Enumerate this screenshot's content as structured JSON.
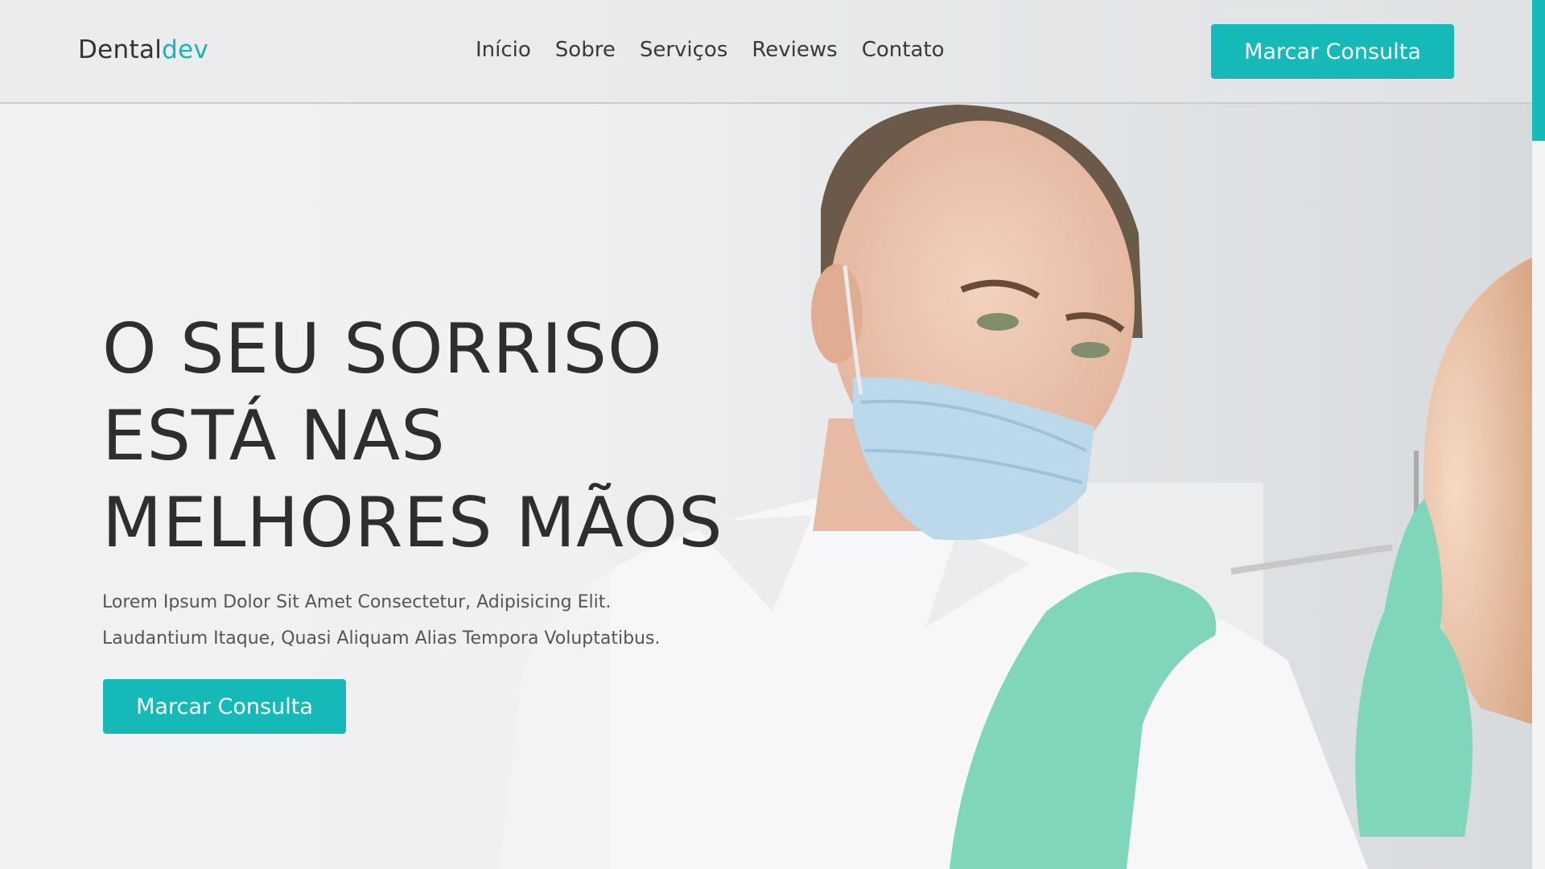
{
  "logo": {
    "part1": "Dental",
    "part2": "dev"
  },
  "nav": {
    "items": [
      {
        "label": "Início"
      },
      {
        "label": "Sobre"
      },
      {
        "label": "Serviços"
      },
      {
        "label": "Reviews"
      },
      {
        "label": "Contato"
      }
    ]
  },
  "header": {
    "cta_label": "Marcar Consulta"
  },
  "hero": {
    "title_lines": [
      "O SEU SORRISO",
      "ESTÁ NAS",
      "MELHORES MÃOS"
    ],
    "subtitle_lines": [
      "Lorem Ipsum Dolor Sit Amet Consectetur, Adipisicing Elit.",
      "Laudantium Itaque, Quasi Aliquam Alias Tempora Voluptatibus."
    ],
    "cta_label": "Marcar Consulta"
  },
  "colors": {
    "accent": "#14b9b8",
    "text": "#2e2e2e"
  }
}
